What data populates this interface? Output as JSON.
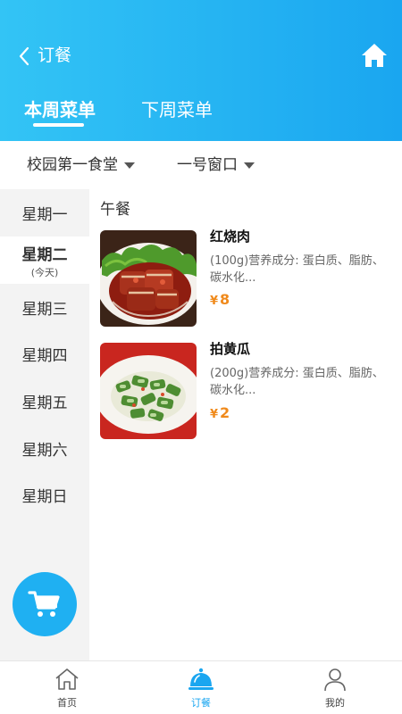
{
  "header": {
    "title": "订餐",
    "back_icon": "chevron-left-icon",
    "home_icon": "home-icon",
    "tabs": [
      {
        "label": "本周菜单",
        "active": true
      },
      {
        "label": "下周菜单",
        "active": false
      }
    ]
  },
  "filters": {
    "canteen": "校园第一食堂",
    "window": "一号窗口"
  },
  "sidebar": {
    "days": [
      {
        "label": "星期一",
        "sub": ""
      },
      {
        "label": "星期二",
        "sub": "(今天)"
      },
      {
        "label": "星期三",
        "sub": ""
      },
      {
        "label": "星期四",
        "sub": ""
      },
      {
        "label": "星期五",
        "sub": ""
      },
      {
        "label": "星期六",
        "sub": ""
      },
      {
        "label": "星期日",
        "sub": ""
      }
    ],
    "active_index": 1
  },
  "menu": {
    "meal_label": "午餐",
    "dishes": [
      {
        "name": "红烧肉",
        "desc": "(100g)营养成分: 蛋白质、脂肪、碳水化...",
        "currency": "¥",
        "price": "8"
      },
      {
        "name": "拍黄瓜",
        "desc": "(200g)营养成分: 蛋白质、脂肪、碳水化...",
        "currency": "¥",
        "price": "2"
      }
    ]
  },
  "cart": {
    "icon": "cart-icon"
  },
  "bottom_nav": [
    {
      "label": "首页",
      "icon": "home-outline-icon",
      "active": false
    },
    {
      "label": "订餐",
      "icon": "cloche-icon",
      "active": true
    },
    {
      "label": "我的",
      "icon": "user-icon",
      "active": false
    }
  ],
  "colors": {
    "accent": "#1aa6f0",
    "price": "#f08a1c"
  }
}
